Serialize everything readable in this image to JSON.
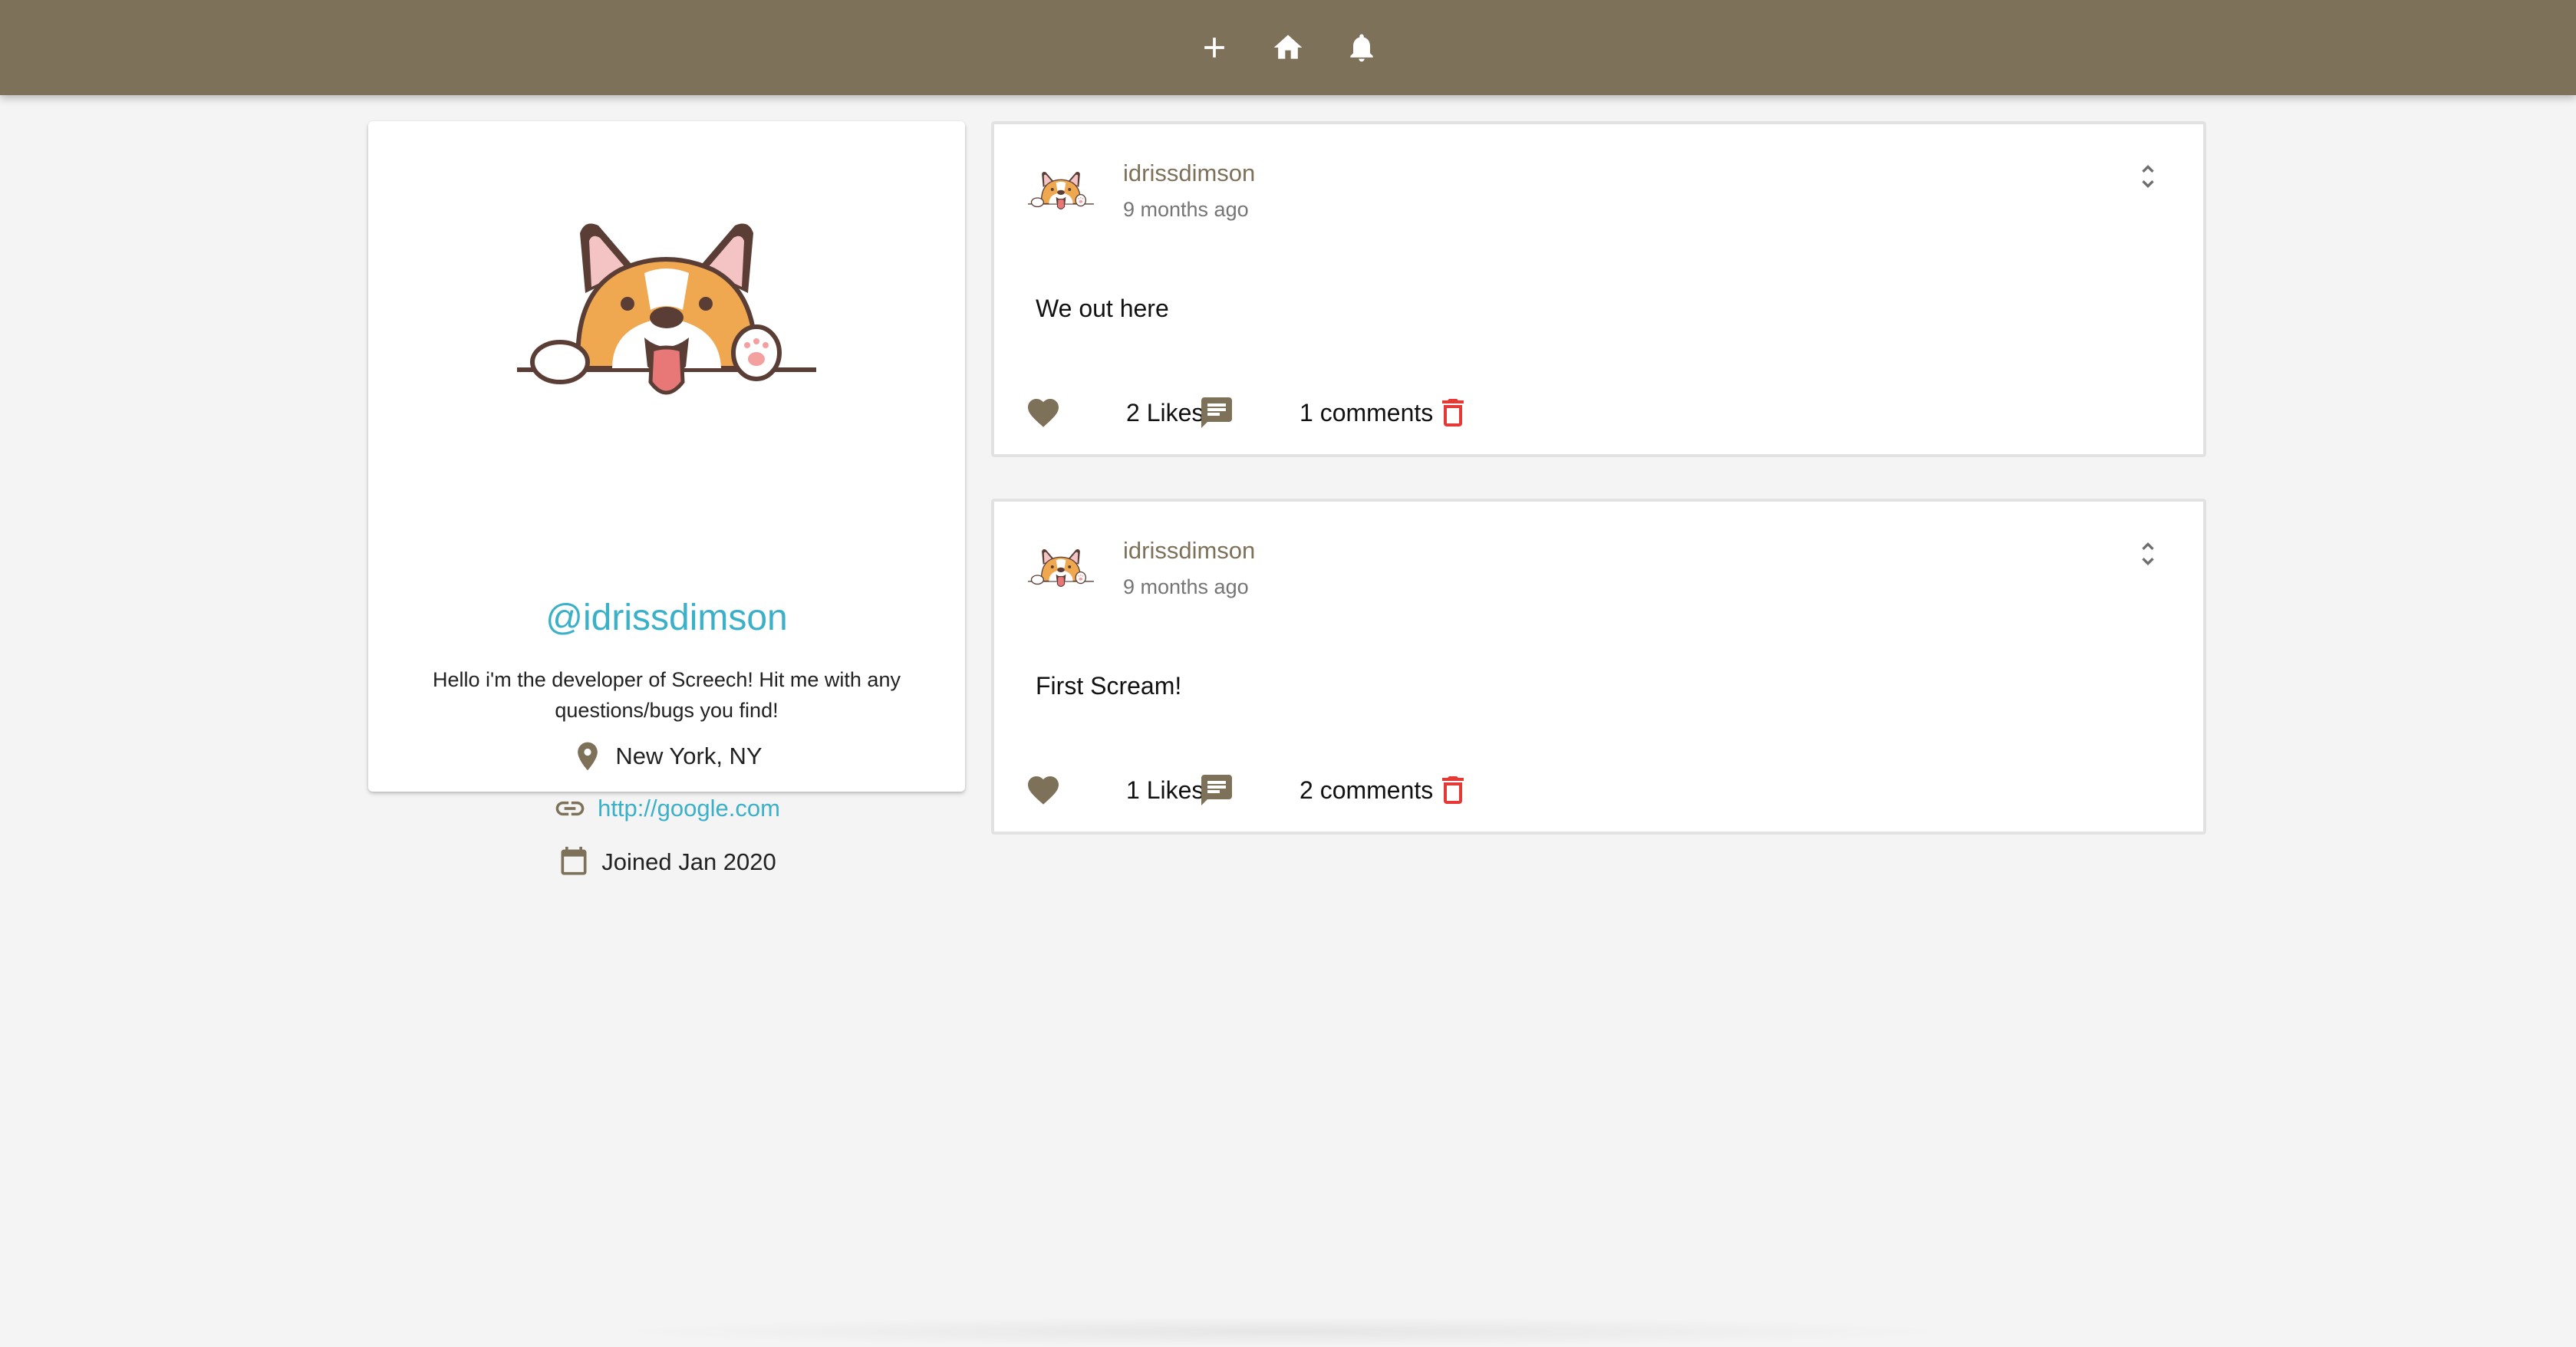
{
  "navbar": {
    "color": "#7e7159",
    "buttons": [
      {
        "icon": "add-icon"
      },
      {
        "icon": "home-icon"
      },
      {
        "icon": "notifications-icon"
      }
    ]
  },
  "profile": {
    "handle": "@idrissdimson",
    "bio": "Hello i'm the developer of Screech! Hit me with any questions/bugs you find!",
    "location": "New York, NY",
    "website": "http://google.com",
    "joined": "Joined Jan 2020",
    "accent_color": "#3ab0c9"
  },
  "posts": [
    {
      "username": "idrissdimson",
      "time": "9 months ago",
      "body": "We out here",
      "likes": "2 Likes",
      "comments": "1 comments"
    },
    {
      "username": "idrissdimson",
      "time": "9 months ago",
      "body": "First Scream!",
      "likes": "1 Likes",
      "comments": "2 comments"
    }
  ],
  "colors": {
    "delete": "#e53935",
    "icon": "#7e7159"
  }
}
